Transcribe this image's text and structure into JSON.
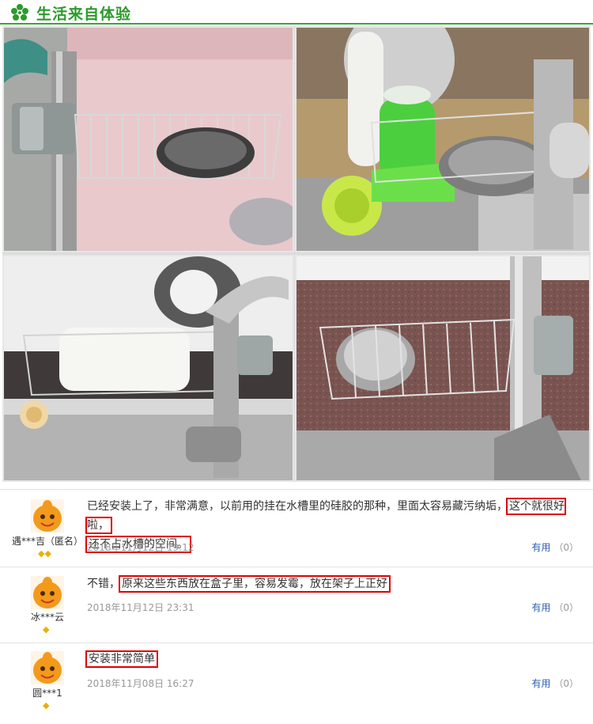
{
  "header": {
    "title": "生活来自体验",
    "logo_icon": "flower-icon",
    "accent_color": "#3aa53a"
  },
  "photos": [
    {
      "subject": "sink-rack-with-steel-wool"
    },
    {
      "subject": "sink-rack-with-brushes"
    },
    {
      "subject": "sink-rack-with-towel"
    },
    {
      "subject": "sink-rack-with-steel-ball"
    }
  ],
  "reviews": [
    {
      "user": "遇***吉（匿名）",
      "avatar_icon": "orange-mascot-avatar",
      "rank_icons": 2,
      "text_part1": "已经安装上了，非常满意，以前用的挂在水槽里的硅胶的那种，里面太容易藏污纳垢，",
      "text_hl1": "这个就很好啦，",
      "text_hl2": "还不占水槽的空间。",
      "date": "2018年11月12日 19:12",
      "useful_label": "有用",
      "useful_count": "（0）"
    },
    {
      "user": "冰***云",
      "avatar_icon": "orange-mascot-avatar",
      "rank_icons": 1,
      "text_part1": "不错，",
      "text_hl1": "原来这些东西放在盒子里，容易发霉，放在架子上正好",
      "date": "2018年11月12日 23:31",
      "useful_label": "有用",
      "useful_count": "（0）"
    },
    {
      "user": "圆***1",
      "avatar_icon": "orange-mascot-avatar",
      "rank_icons": 1,
      "text_hl1": "安装非常简单",
      "date": "2018年11月08日 16:27",
      "useful_label": "有用",
      "useful_count": "（0）"
    }
  ],
  "highlight_color": "#e00000",
  "rank_color": "#e9b100"
}
